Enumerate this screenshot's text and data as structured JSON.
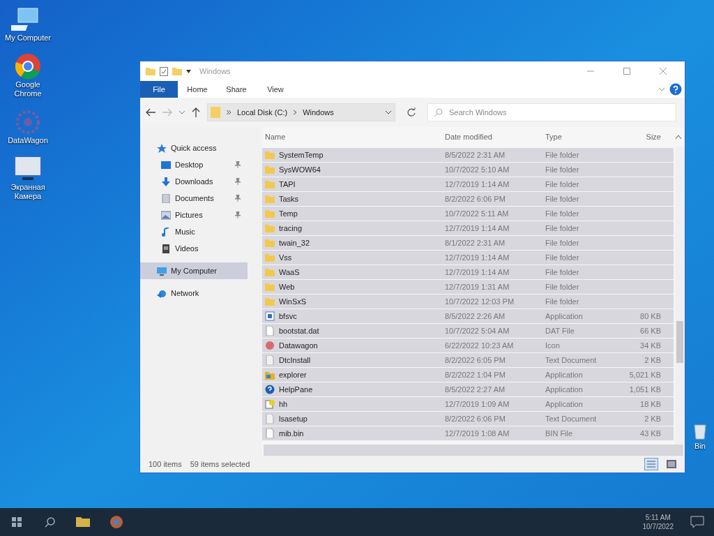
{
  "desktop_icons": [
    {
      "label": "My Computer",
      "kind": "computer"
    },
    {
      "label": "Google Chrome",
      "kind": "chrome"
    },
    {
      "label": "DataWagon",
      "kind": "wagon"
    },
    {
      "label": "Экранная Камера",
      "kind": "monitor"
    }
  ],
  "recycle_bin": {
    "label": "Bin"
  },
  "window": {
    "title": "Windows",
    "ribbon_tabs": [
      {
        "label": "File",
        "selected": true
      },
      {
        "label": "Home",
        "selected": false
      },
      {
        "label": "Share",
        "selected": false
      },
      {
        "label": "View",
        "selected": false
      }
    ],
    "breadcrumb": [
      "Local Disk (C:)",
      "Windows"
    ],
    "search": {
      "placeholder": "Search Windows"
    },
    "nav": [
      {
        "label": "Quick access",
        "kind": "star",
        "selected": false,
        "children": [
          {
            "label": "Desktop",
            "kind": "desktop",
            "pinned": true,
            "selected": false
          },
          {
            "label": "Downloads",
            "kind": "download",
            "pinned": true,
            "selected": false
          },
          {
            "label": "Documents",
            "kind": "document",
            "pinned": true,
            "selected": false
          },
          {
            "label": "Pictures",
            "kind": "picture",
            "pinned": true,
            "selected": false
          },
          {
            "label": "Music",
            "kind": "music",
            "pinned": false,
            "selected": false
          },
          {
            "label": "Videos",
            "kind": "video",
            "pinned": false,
            "selected": false
          }
        ]
      },
      {
        "label": "My Computer",
        "kind": "computer",
        "selected": true
      },
      {
        "label": "Network",
        "kind": "network",
        "selected": false
      }
    ],
    "columns": [
      "Name",
      "Date modified",
      "Type",
      "Size"
    ],
    "rows": [
      {
        "kind": "folder",
        "name": "SystemTemp",
        "date": "8/5/2022 2:31 AM",
        "type": "File folder",
        "selected": true
      },
      {
        "kind": "folder",
        "name": "SysWOW64",
        "date": "10/7/2022 5:10 AM",
        "type": "File folder",
        "selected": true
      },
      {
        "kind": "folder",
        "name": "TAPI",
        "date": "12/7/2019 1:14 AM",
        "type": "File folder",
        "selected": true
      },
      {
        "kind": "folder",
        "name": "Tasks",
        "date": "8/2/2022 6:06 PM",
        "type": "File folder",
        "selected": true
      },
      {
        "kind": "folder",
        "name": "Temp",
        "date": "10/7/2022 5:11 AM",
        "type": "File folder",
        "selected": true
      },
      {
        "kind": "folder",
        "name": "tracing",
        "date": "12/7/2019 1:14 AM",
        "type": "File folder",
        "selected": true
      },
      {
        "kind": "folder",
        "name": "twain_32",
        "date": "8/1/2022 2:31 AM",
        "type": "File folder",
        "selected": true
      },
      {
        "kind": "folder",
        "name": "Vss",
        "date": "12/7/2019 1:14 AM",
        "type": "File folder",
        "selected": true
      },
      {
        "kind": "folder",
        "name": "WaaS",
        "date": "12/7/2019 1:14 AM",
        "type": "File folder",
        "selected": true
      },
      {
        "kind": "folder",
        "name": "Web",
        "date": "12/7/2019 1:31 AM",
        "type": "File folder",
        "selected": true
      },
      {
        "kind": "folder",
        "name": "WinSxS",
        "date": "10/7/2022 12:03 PM",
        "type": "File folder",
        "selected": true
      },
      {
        "kind": "app",
        "name": "bfsvc",
        "date": "8/5/2022 2:26 AM",
        "type": "Application",
        "size": "80 KB",
        "selected": true
      },
      {
        "kind": "file",
        "name": "bootstat.dat",
        "date": "10/7/2022 5:04 AM",
        "type": "DAT File",
        "size": "66 KB",
        "selected": true
      },
      {
        "kind": "dot",
        "name": "Datawagon",
        "date": "6/22/2022 10:23 AM",
        "type": "Icon",
        "size": "34 KB",
        "selected": true
      },
      {
        "kind": "text",
        "name": "DtcInstall",
        "date": "8/2/2022 6:05 PM",
        "type": "Text Document",
        "size": "2 KB",
        "selected": true
      },
      {
        "kind": "explorer",
        "name": "explorer",
        "date": "8/2/2022 1:04 PM",
        "type": "Application",
        "size": "5,021 KB",
        "selected": true
      },
      {
        "kind": "help",
        "name": "HelpPane",
        "date": "8/5/2022 2:27 AM",
        "type": "Application",
        "size": "1,051 KB",
        "selected": true
      },
      {
        "kind": "hh",
        "name": "hh",
        "date": "12/7/2019 1:09 AM",
        "type": "Application",
        "size": "18 KB",
        "selected": true
      },
      {
        "kind": "text",
        "name": "lsasetup",
        "date": "8/2/2022 6:06 PM",
        "type": "Text Document",
        "size": "2 KB",
        "selected": true
      },
      {
        "kind": "file",
        "name": "mib.bin",
        "date": "12/7/2019 1:08 AM",
        "type": "BIN File",
        "size": "43 KB",
        "selected": true
      }
    ],
    "status": [
      "100 items",
      "59 items selected"
    ]
  },
  "taskbar": {
    "time": "5:11 AM",
    "date": "10/7/2022"
  }
}
